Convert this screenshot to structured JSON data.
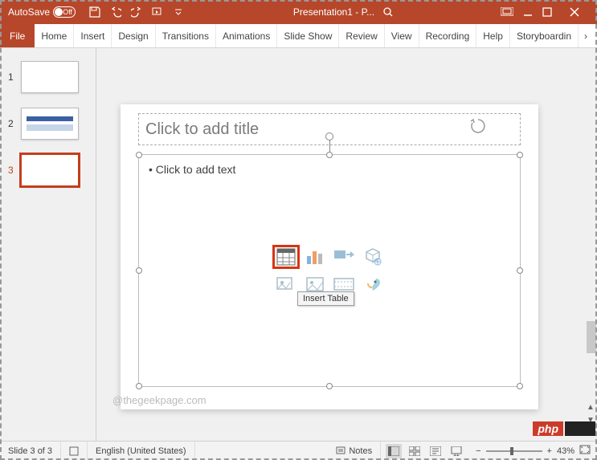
{
  "titlebar": {
    "autosave_label": "AutoSave",
    "autosave_state": "Off",
    "doc_title": "Presentation1 - P..."
  },
  "ribbon": {
    "tabs": [
      "File",
      "Home",
      "Insert",
      "Design",
      "Transitions",
      "Animations",
      "Slide Show",
      "Review",
      "View",
      "Recording",
      "Help",
      "Storyboardin"
    ]
  },
  "thumbs": {
    "count": 3,
    "selected": 3
  },
  "slide": {
    "title_placeholder": "Click to add title",
    "content_placeholder": "• Click to add text",
    "icons": [
      "table",
      "chart",
      "smartart",
      "3d-model",
      "stock-images",
      "pictures",
      "online-video",
      "icons"
    ],
    "tooltip": "Insert Table"
  },
  "watermark": "@thegeekpage.com",
  "status": {
    "slide_info": "Slide 3 of 3",
    "language": "English (United States)",
    "notes_label": "Notes",
    "zoom_percent": "43%"
  },
  "badges": {
    "php": "php"
  }
}
